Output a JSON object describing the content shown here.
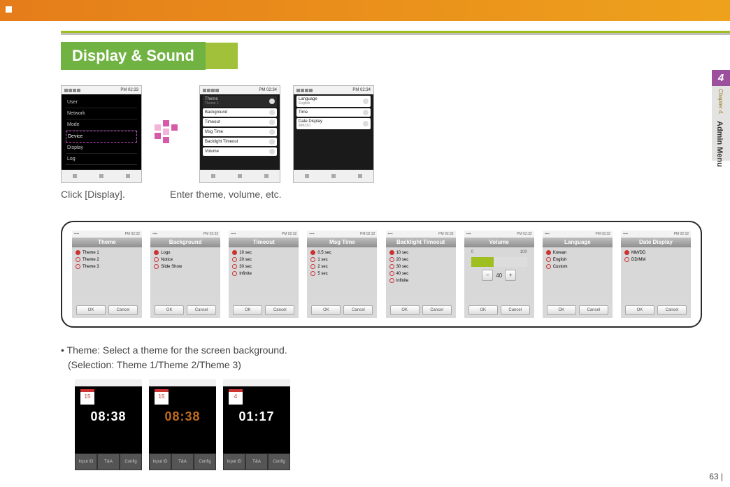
{
  "header": {
    "section_title": "Display & Sound"
  },
  "side": {
    "number": "4",
    "chapter": "Chapter 4.",
    "label": "Admin Menu"
  },
  "step1": {
    "time": "PM 02:33",
    "items": [
      "User",
      "Network",
      "Mode",
      "Device",
      "Display",
      "Log"
    ],
    "highlight_index": 3,
    "caption": "Click [Display]."
  },
  "step2": {
    "time": "PM 02:34",
    "caption": "Enter theme, volume, etc.",
    "screenA": [
      {
        "label": "Theme",
        "sub": "Theme 1"
      },
      {
        "label": "Background",
        "sub": ""
      },
      {
        "label": "Timeout",
        "sub": ""
      },
      {
        "label": "Msg Time",
        "sub": ""
      },
      {
        "label": "Backlight Timeout",
        "sub": ""
      },
      {
        "label": "Volume",
        "sub": ""
      }
    ],
    "screenB": [
      {
        "label": "Language",
        "sub": "English"
      },
      {
        "label": "Time",
        "sub": ""
      },
      {
        "label": "Date Display",
        "sub": "MM/DD"
      }
    ]
  },
  "detail": {
    "time": "PM 02:32",
    "ok": "OK",
    "cancel": "Cancel",
    "panels": [
      {
        "title": "Theme",
        "type": "radio",
        "options": [
          "Theme 1",
          "Theme 2",
          "Theme 3"
        ]
      },
      {
        "title": "Background",
        "type": "radio",
        "options": [
          "Logo",
          "Notice",
          "Slide Show"
        ]
      },
      {
        "title": "Timeout",
        "type": "radio",
        "options": [
          "10 sec",
          "20 sec",
          "30 sec",
          "Infinite"
        ]
      },
      {
        "title": "Msg Time",
        "type": "radio",
        "options": [
          "0.5 sec",
          "1 sec",
          "2 sec",
          "5 sec"
        ]
      },
      {
        "title": "Backlight Timeout",
        "type": "radio",
        "options": [
          "10 sec",
          "20 sec",
          "30 sec",
          "40 sec",
          "Infinite"
        ]
      },
      {
        "title": "Volume",
        "type": "volume",
        "value": 40,
        "min": 0,
        "max": 100
      },
      {
        "title": "Language",
        "type": "radio",
        "options": [
          "Korean",
          "English",
          "Custom"
        ]
      },
      {
        "title": "Date Display",
        "type": "radio",
        "options": [
          "MM/DD",
          "DD/MM"
        ]
      }
    ]
  },
  "notes": {
    "line1": "• Theme: Select a theme for the screen background.",
    "line2": "(Selection: Theme 1/Theme 2/Theme 3)",
    "thumbs": [
      {
        "time": "08:38",
        "day": "15",
        "bottom": [
          "Input ID",
          "T&A",
          "Config"
        ]
      },
      {
        "time": "08:38",
        "day": "15",
        "bottom": [
          "Input ID",
          "T&A",
          "Config"
        ]
      },
      {
        "time": "01:17",
        "day": "4",
        "bottom": [
          "Input ID",
          "T&A",
          "Config"
        ]
      }
    ]
  },
  "page": "63"
}
